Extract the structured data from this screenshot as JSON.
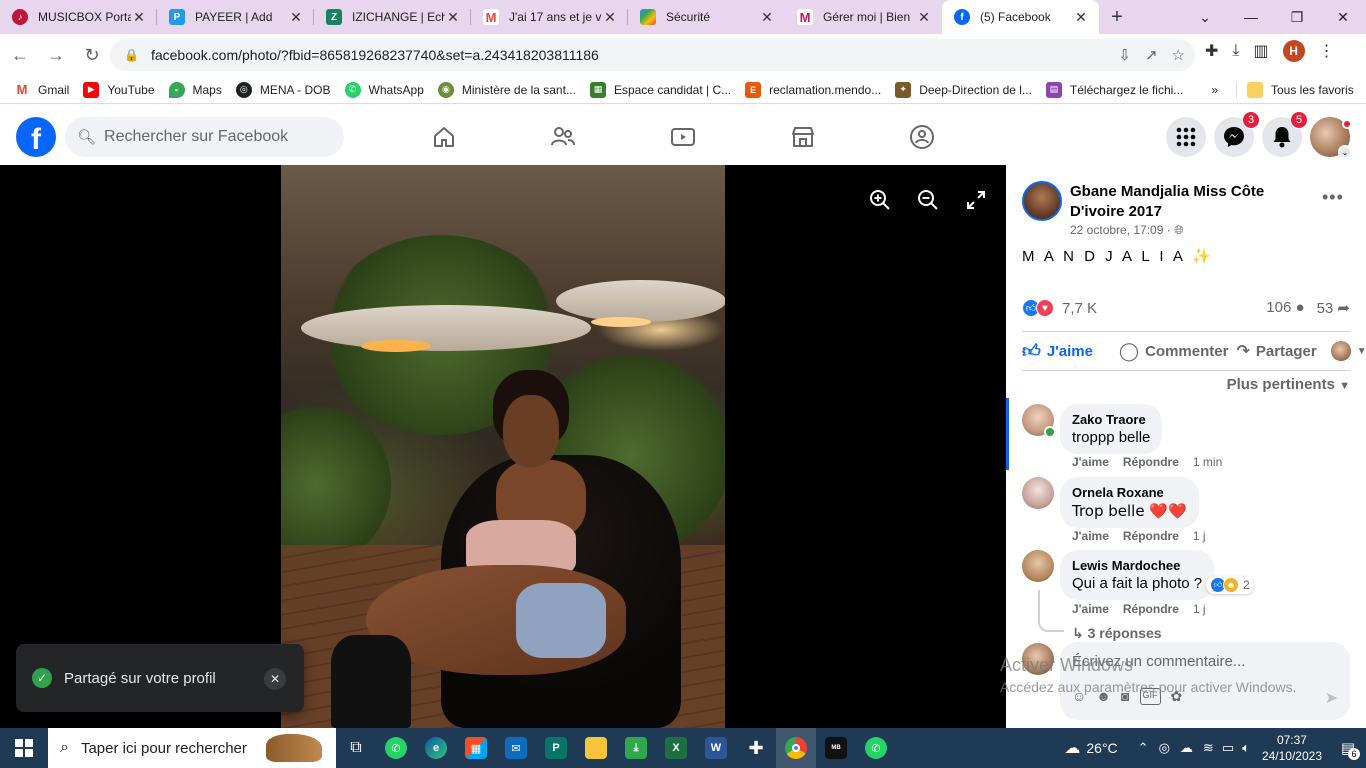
{
  "browser": {
    "tabs": [
      {
        "title": "MUSICBOX Porta",
        "icon": "musicbox-icon",
        "color": "#c0143c"
      },
      {
        "title": "PAYEER | Add",
        "icon": "payeer-icon",
        "color": "#1e9be9"
      },
      {
        "title": "IZICHANGE | Ech",
        "icon": "izichange-icon",
        "color": "#18835f"
      },
      {
        "title": "J'ai 17 ans et je v",
        "icon": "gmail-icon",
        "color": "#ea4335"
      },
      {
        "title": "Sécurité",
        "icon": "google-account-icon",
        "color": "#e37400"
      },
      {
        "title": "Gérer moi | Bien",
        "icon": "m-logo-icon",
        "color": "#c2185b"
      },
      {
        "title": "(5) Facebook",
        "icon": "facebook-icon",
        "color": "#0866ff"
      }
    ],
    "url": "facebook.com/photo/?fbid=865819268237740&set=a.243418203811186",
    "profile_initial": "H",
    "bookmarks": [
      {
        "label": "Gmail",
        "color": "#ea4335"
      },
      {
        "label": "YouTube",
        "color": "#ff0000"
      },
      {
        "label": "Maps",
        "color": "#34a853"
      },
      {
        "label": "MENA - DOB",
        "color": "#202124"
      },
      {
        "label": "WhatsApp",
        "color": "#25d366"
      },
      {
        "label": "Ministère de la sant...",
        "color": "#6a8f3a"
      },
      {
        "label": "Espace candidat | C...",
        "color": "#3a7d2c"
      },
      {
        "label": "reclamation.mendo...",
        "color": "#e8590c"
      },
      {
        "label": "Deep-Direction de l...",
        "color": "#7a5a2a"
      },
      {
        "label": "Téléchargez le fichi...",
        "color": "#8e44ad"
      }
    ],
    "bookmarks_overflow": "»",
    "all_bookmarks": "Tous les favoris"
  },
  "facebook": {
    "search_placeholder": "Rechercher sur Facebook",
    "messenger_badge": "3",
    "notifications_badge": "5"
  },
  "toast": {
    "text": "Partagé sur votre profil"
  },
  "post": {
    "author": "Gbane Mandjalia Miss Côte D'ivoire 2017",
    "date": "22 octobre, 17:09 ·",
    "caption": "M A N D J A L I A ✨",
    "reactions_count": "7,7 K",
    "comments_count": "106",
    "shares_count": "53",
    "like_label": "J'aime",
    "comment_label": "Commenter",
    "share_label": "Partager",
    "sort_label": "Plus pertinents"
  },
  "comments": [
    {
      "name": "Zako Traore",
      "text": "troppp belle",
      "like": "J'aime",
      "reply": "Répondre",
      "time": "1 min"
    },
    {
      "name": "Ornela Roxane",
      "text": "Trop belle ❤️❤️",
      "like": "J'aime",
      "reply": "Répondre",
      "time": "1 j"
    },
    {
      "name": "Lewis Mardochee",
      "text": "Qui a fait la photo ?",
      "like": "J'aime",
      "reply": "Répondre",
      "time": "1 j",
      "reactions": "2"
    }
  ],
  "replies_label": "3 réponses",
  "composer_placeholder": "Écrivez un commentaire...",
  "watermark": {
    "line1": "Activer Windows",
    "line2": "Accédez aux paramètres pour activer Windows."
  },
  "taskbar": {
    "search_placeholder": "Taper ici pour rechercher",
    "weather": "26°C",
    "time": "07:37",
    "date": "24/10/2023",
    "notif_count": "6"
  }
}
